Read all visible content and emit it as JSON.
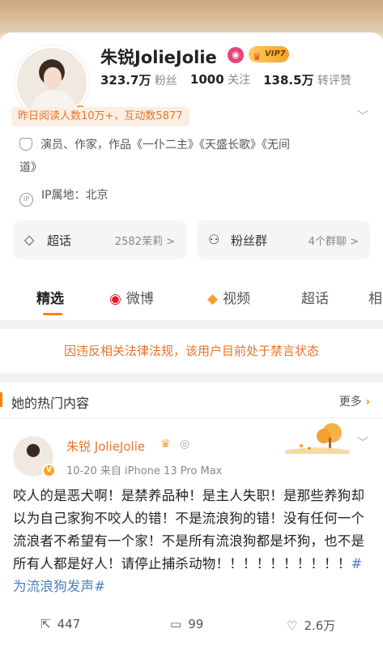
{
  "profile": {
    "name": "朱锐JolieJolie",
    "vip_label": "VIP7",
    "stats": [
      {
        "num": "323.7万",
        "label": "粉丝"
      },
      {
        "num": "1000",
        "label": "关注"
      },
      {
        "num": "138.5万",
        "label": "转评赞"
      }
    ],
    "highlight": "昨日阅读人数10万+，互动数5877",
    "bio_line1": "演员、作家，作品《一仆二主》《天盛长歌》《无间",
    "bio_line2": "道》",
    "ip_label": "IP属地：北京",
    "ip_icon_text": "IP"
  },
  "cards": [
    {
      "title": "超话",
      "count": "2582茉莉 >"
    },
    {
      "title": "粉丝群",
      "count": "4个群聊 >"
    }
  ],
  "tabs": [
    {
      "label": "精选"
    },
    {
      "label": "微博"
    },
    {
      "label": "视频"
    },
    {
      "label": "超话"
    },
    {
      "label": "相"
    }
  ],
  "notice": "因违反相关法律法规，该用户目前处于禁言状态",
  "hot": {
    "title": "她的热门内容",
    "more": "更多",
    "post": {
      "author": "朱锐 JolieJolie",
      "meta": "10-20  来自 iPhone 13 Pro Max",
      "body": "咬人的是恶犬啊！是禁养品种！是主人失职！是那些养狗却以为自己家狗不咬人的错！不是流浪狗的错！没有任何一个流浪者不希望有一个家！不是所有流浪狗都是坏狗，也不是所有人都是好人！请停止捕杀动物！！！！！！！！！！",
      "tag": "#为流浪狗发声#",
      "reposts": "447",
      "comments": "99",
      "likes": "2.6万"
    }
  },
  "colors": {
    "accent": "#ff8200",
    "link": "#4a7fc1",
    "orange_text": "#e8742b"
  }
}
